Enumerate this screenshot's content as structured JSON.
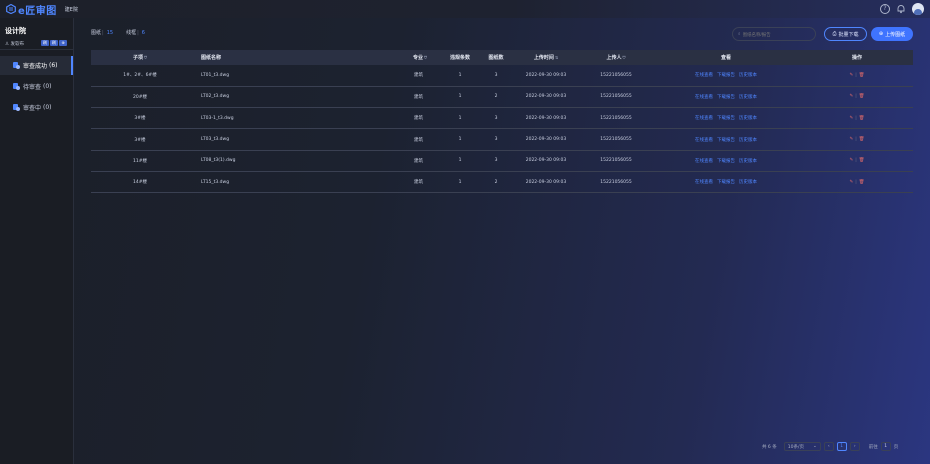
{
  "app": {
    "logo_text": "e匠审图",
    "subtitle": "建E院"
  },
  "sidebar": {
    "title": "设计院",
    "user": "发软布",
    "badges": [
      "刷",
      "刷",
      "⊕"
    ],
    "items": [
      {
        "label": "审查成功",
        "count": "(6)"
      },
      {
        "label": "待审查",
        "count": "(0)"
      },
      {
        "label": "审查中",
        "count": "(0)"
      }
    ]
  },
  "tabs": [
    {
      "label": "图纸",
      "count": "15"
    },
    {
      "label": "线框",
      "count": "6"
    }
  ],
  "search": {
    "placeholder": "图纸名称/报告"
  },
  "buttons": {
    "batch_download": "批量下载",
    "upload": "上传图纸"
  },
  "table": {
    "headers": [
      "子项",
      "图纸名称",
      "专业",
      "违规条数",
      "图纸数",
      "上传时间",
      "上传人",
      "查看",
      "操作"
    ],
    "rows": [
      {
        "sub": "1#、2#、6#楼",
        "name": "LT01_t3.dwg",
        "major": "建筑",
        "violations": "1",
        "sheets": "3",
        "time": "2022-09-30 09:03",
        "uploader": "15221056055"
      },
      {
        "sub": "20#楼",
        "name": "LT02_t3.dwg",
        "major": "建筑",
        "violations": "1",
        "sheets": "2",
        "time": "2022-09-30 09:03",
        "uploader": "15221056055"
      },
      {
        "sub": "3#楼",
        "name": "LT03-1_t3.dwg",
        "major": "建筑",
        "violations": "1",
        "sheets": "3",
        "time": "2022-09-30 09:03",
        "uploader": "15221056055"
      },
      {
        "sub": "3#楼",
        "name": "LT03_t3.dwg",
        "major": "建筑",
        "violations": "1",
        "sheets": "3",
        "time": "2022-09-30 09:03",
        "uploader": "15221056055"
      },
      {
        "sub": "11#楼",
        "name": "LT08_t3(1).dwg",
        "major": "建筑",
        "violations": "1",
        "sheets": "3",
        "time": "2022-09-30 09:03",
        "uploader": "15221056055"
      },
      {
        "sub": "14#楼",
        "name": "LT15_t3.dwg",
        "major": "建筑",
        "violations": "1",
        "sheets": "2",
        "time": "2022-09-30 09:03",
        "uploader": "15221056055"
      }
    ],
    "view_links": [
      "在线查看",
      "下载报告",
      "历史版本"
    ]
  },
  "pagination": {
    "total": "共 6 条",
    "page_size": "10条/页",
    "current": "1",
    "goto_label": "前往",
    "goto_value": "1",
    "page_unit": "页"
  }
}
